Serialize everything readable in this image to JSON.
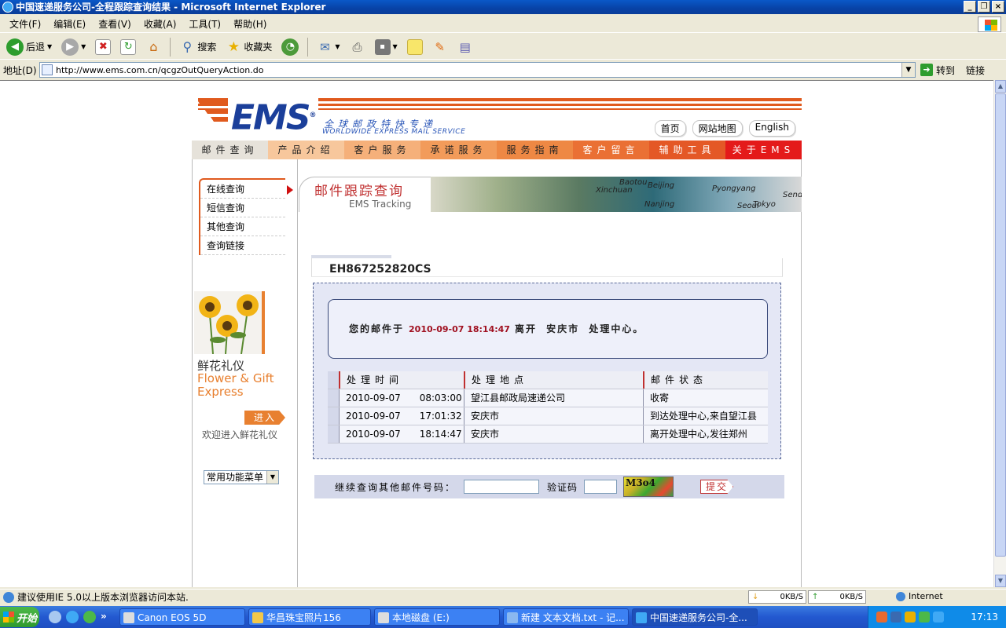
{
  "window": {
    "title": "中国速递服务公司-全程跟踪查询结果 - Microsoft Internet Explorer",
    "controls": [
      "_",
      "❐",
      "×"
    ]
  },
  "menu": [
    "文件(F)",
    "编辑(E)",
    "查看(V)",
    "收藏(A)",
    "工具(T)",
    "帮助(H)"
  ],
  "toolbar": {
    "back": "后退",
    "search": "搜索",
    "favorites": "收藏夹"
  },
  "address": {
    "label": "地址(D)",
    "url": "http://www.ems.com.cn/qcgzOutQueryAction.do",
    "go": "转到",
    "links": "链接"
  },
  "ems": {
    "logo": "EMS",
    "registered": "®",
    "tagline_cn": "全球邮政特快专递",
    "tagline_en": "WORLDWIDE EXPRESS MAIL SERVICE",
    "top_links": [
      "首页",
      "网站地图",
      "English"
    ],
    "nav": [
      {
        "label": "邮件查询",
        "color": "#E6E2DA"
      },
      {
        "label": "产品介绍",
        "color": "#F7C79C"
      },
      {
        "label": "客户服务",
        "color": "#F5B07A"
      },
      {
        "label": "承诺服务",
        "color": "#F29B5A"
      },
      {
        "label": "服务指南",
        "color": "#EE8844"
      },
      {
        "label": "客户留言",
        "color": "#EA7034"
      },
      {
        "label": "辅助工具",
        "color": "#E45826"
      },
      {
        "label": "关于EMS",
        "color": "#E41A1A"
      }
    ],
    "side_menu": [
      "在线查询",
      "短信查询",
      "其他查询",
      "查询链接"
    ],
    "flower": {
      "cn": "鲜花礼仪",
      "en_line1": "Flower & Gift",
      "en_line2": "Express",
      "enter": "进入",
      "welcome": "欢迎进入鲜花礼仪"
    },
    "select": "常用功能菜单",
    "banner": {
      "title_cn": "邮件跟踪查询",
      "title_en": "EMS Tracking",
      "map_labels": [
        "Baotou",
        "Beijing",
        "Pyongyang",
        "Seoul",
        "Sendai",
        "Tokyo",
        "Xinchuan",
        "Nanjing"
      ]
    },
    "tracking_number": "EH867252820CS",
    "status": {
      "prefix": "您的邮件于",
      "datetime": "2010-09-07 18:14:47",
      "action": "离开",
      "city": "安庆市",
      "place": "处理中心。"
    },
    "table": {
      "headers": [
        "处理时间",
        "处理地点",
        "邮件状态"
      ],
      "rows": [
        {
          "time": "2010-09-07　　08:03:00",
          "place": "望江县邮政局速递公司",
          "status": "收寄"
        },
        {
          "time": "2010-09-07　　17:01:32",
          "place": "安庆市",
          "status": "到达处理中心,来自望江县"
        },
        {
          "time": "2010-09-07　　18:14:47",
          "place": "安庆市",
          "status": "离开处理中心,发往郑州"
        }
      ]
    },
    "query": {
      "label": "继续查询其他邮件号码：",
      "verify": "验证码",
      "captcha": "M3o4",
      "submit": "提交"
    }
  },
  "statusbar": {
    "message": "建议使用IE 5.0以上版本浏览器访问本站.",
    "down": "0KB/S",
    "up": "0KB/S",
    "zone": "Internet"
  },
  "taskbar": {
    "start": "开始",
    "tasks": [
      "Canon EOS 5D",
      "华昌珠宝照片156",
      "本地磁盘 (E:)",
      "新建 文本文档.txt - 记...",
      "中国速递服务公司-全..."
    ],
    "clock": "17:13"
  }
}
